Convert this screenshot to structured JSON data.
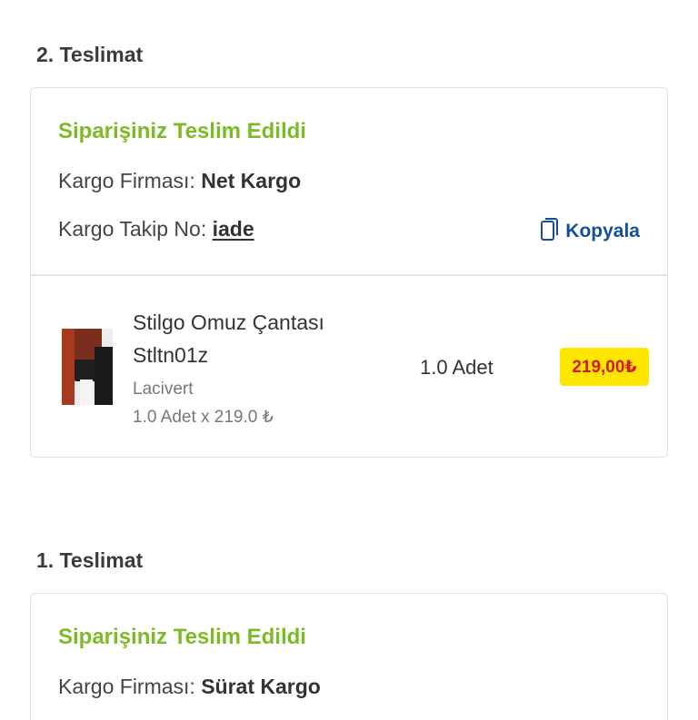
{
  "deliveries": [
    {
      "title": "2. Teslimat",
      "status": "Siparişiniz Teslim Edildi",
      "carrier_label": "Kargo Firması:",
      "carrier": "Net Kargo",
      "tracking_label": "Kargo Takip No:",
      "tracking_no": "iade",
      "copy_label": "Kopyala",
      "product": {
        "name": "Stilgo Omuz Çantası Stltn01z",
        "variant": "Lacivert",
        "qty_detail": "1.0 Adet x 219.0 ₺",
        "qty": "1.0 Adet",
        "price": "219,00₺"
      }
    },
    {
      "title": "1. Teslimat",
      "status": "Siparişiniz Teslim Edildi",
      "carrier_label": "Kargo Firması:",
      "carrier": "Sürat Kargo"
    }
  ],
  "colors": {
    "status_green": "#7cbb25",
    "link_blue": "#154f9c",
    "price_bg": "#ffe600",
    "price_text": "#d21c1c"
  },
  "icons": {
    "copy": "copy-icon"
  }
}
